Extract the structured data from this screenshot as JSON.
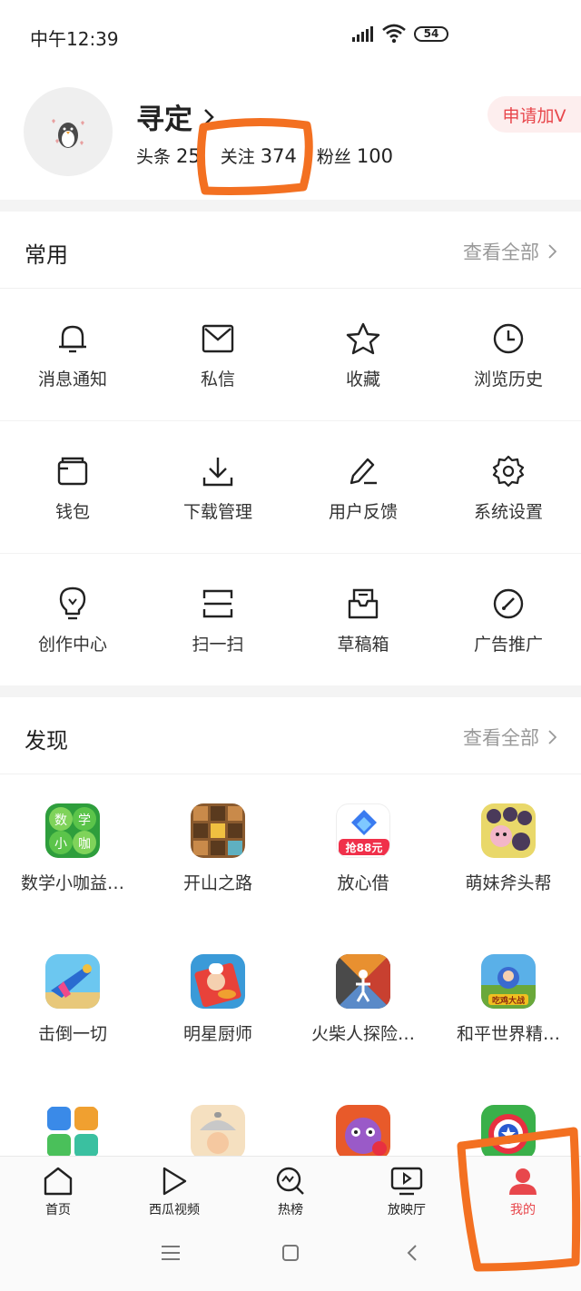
{
  "status_bar": {
    "time": "中午12:39",
    "battery": "54"
  },
  "profile": {
    "name": "寻定",
    "stats": [
      {
        "label": "头条",
        "value": "25"
      },
      {
        "label": "关注",
        "value": "374"
      },
      {
        "label": "粉丝",
        "value": "100"
      }
    ],
    "apply_button": "申请加V"
  },
  "common": {
    "title": "常用",
    "see_all": "查看全部",
    "items": [
      {
        "label": "消息通知",
        "icon": "bell-icon"
      },
      {
        "label": "私信",
        "icon": "mail-icon"
      },
      {
        "label": "收藏",
        "icon": "star-icon"
      },
      {
        "label": "浏览历史",
        "icon": "clock-icon"
      },
      {
        "label": "钱包",
        "icon": "wallet-icon"
      },
      {
        "label": "下载管理",
        "icon": "download-icon"
      },
      {
        "label": "用户反馈",
        "icon": "pen-icon"
      },
      {
        "label": "系统设置",
        "icon": "gear-icon"
      },
      {
        "label": "创作中心",
        "icon": "lightbulb-icon"
      },
      {
        "label": "扫一扫",
        "icon": "scan-icon"
      },
      {
        "label": "草稿箱",
        "icon": "drafts-icon"
      },
      {
        "label": "广告推广",
        "icon": "gauge-icon"
      }
    ]
  },
  "discover": {
    "title": "发现",
    "see_all": "查看全部",
    "apps": [
      {
        "label": "数学小咖益…",
        "icon": "math-game-icon",
        "tile_text": [
          "数",
          "学",
          "小",
          "咖"
        ]
      },
      {
        "label": "开山之路",
        "icon": "block-puzzle-icon"
      },
      {
        "label": "放心借",
        "icon": "loan-app-icon",
        "tile_text": "抢88元"
      },
      {
        "label": "萌妹斧头帮",
        "icon": "cartoon-game-icon"
      },
      {
        "label": "击倒一切",
        "icon": "shooter-game-icon"
      },
      {
        "label": "明星厨师",
        "icon": "chef-game-icon"
      },
      {
        "label": "火柴人探险…",
        "icon": "stickman-game-icon"
      },
      {
        "label": "和平世界精…",
        "icon": "battle-game-icon",
        "tile_text": "吃鸡大战"
      },
      {
        "label": "",
        "icon": "gem-puzzle-icon"
      },
      {
        "label": "",
        "icon": "cooking-game-icon"
      },
      {
        "label": "",
        "icon": "monster-game-icon"
      },
      {
        "label": "",
        "icon": "shield-game-icon"
      }
    ]
  },
  "bottom_nav": [
    {
      "label": "首页",
      "icon": "home-icon"
    },
    {
      "label": "西瓜视频",
      "icon": "play-icon"
    },
    {
      "label": "热榜",
      "icon": "trending-icon"
    },
    {
      "label": "放映厅",
      "icon": "screen-play-icon"
    },
    {
      "label": "我的",
      "icon": "user-icon",
      "active": true
    }
  ],
  "colors": {
    "accent": "#e8474c",
    "annotation": "#f37021"
  }
}
